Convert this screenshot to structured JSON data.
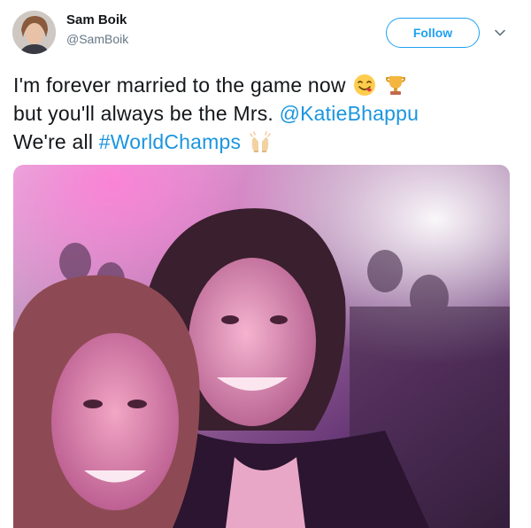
{
  "user": {
    "name": "Sam Boik",
    "handle": "@SamBoik"
  },
  "follow_label": "Follow",
  "icons": {
    "more": "chevron-down-icon",
    "emoji_1": "face-savoring-food-emoji",
    "emoji_2": "trophy-emoji",
    "emoji_3": "raising-hands-emoji"
  },
  "tweet": {
    "line1": "I'm forever married to the game now",
    "line2_text": "but you'll always be the Mrs.",
    "line2_mention": "@KatieBhappu",
    "line3_text": "We're all",
    "line3_hashtag": "#WorldChamps"
  },
  "colors": {
    "brand": "#1da1f2",
    "link": "#1b95e0",
    "text": "#14171a",
    "secondary": "#657786"
  }
}
